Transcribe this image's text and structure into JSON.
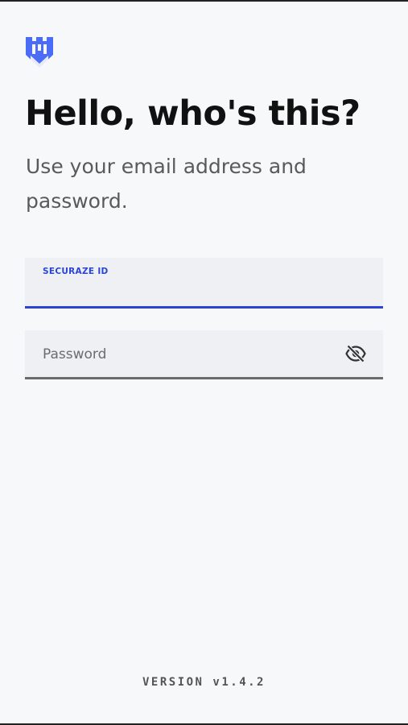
{
  "brand": {
    "logo_icon": "shield-logo-icon",
    "color": "#4a6cf7"
  },
  "header": {
    "title": "Hello, who's this?",
    "subtitle": "Use your email address and password."
  },
  "form": {
    "id_field": {
      "label": "SECURAZE ID",
      "value": "",
      "accent_color": "#2a45d6"
    },
    "password_field": {
      "placeholder": "Password",
      "value": "",
      "toggle_icon": "eye-off-icon"
    }
  },
  "footer": {
    "version": "VERSION v1.4.2"
  }
}
